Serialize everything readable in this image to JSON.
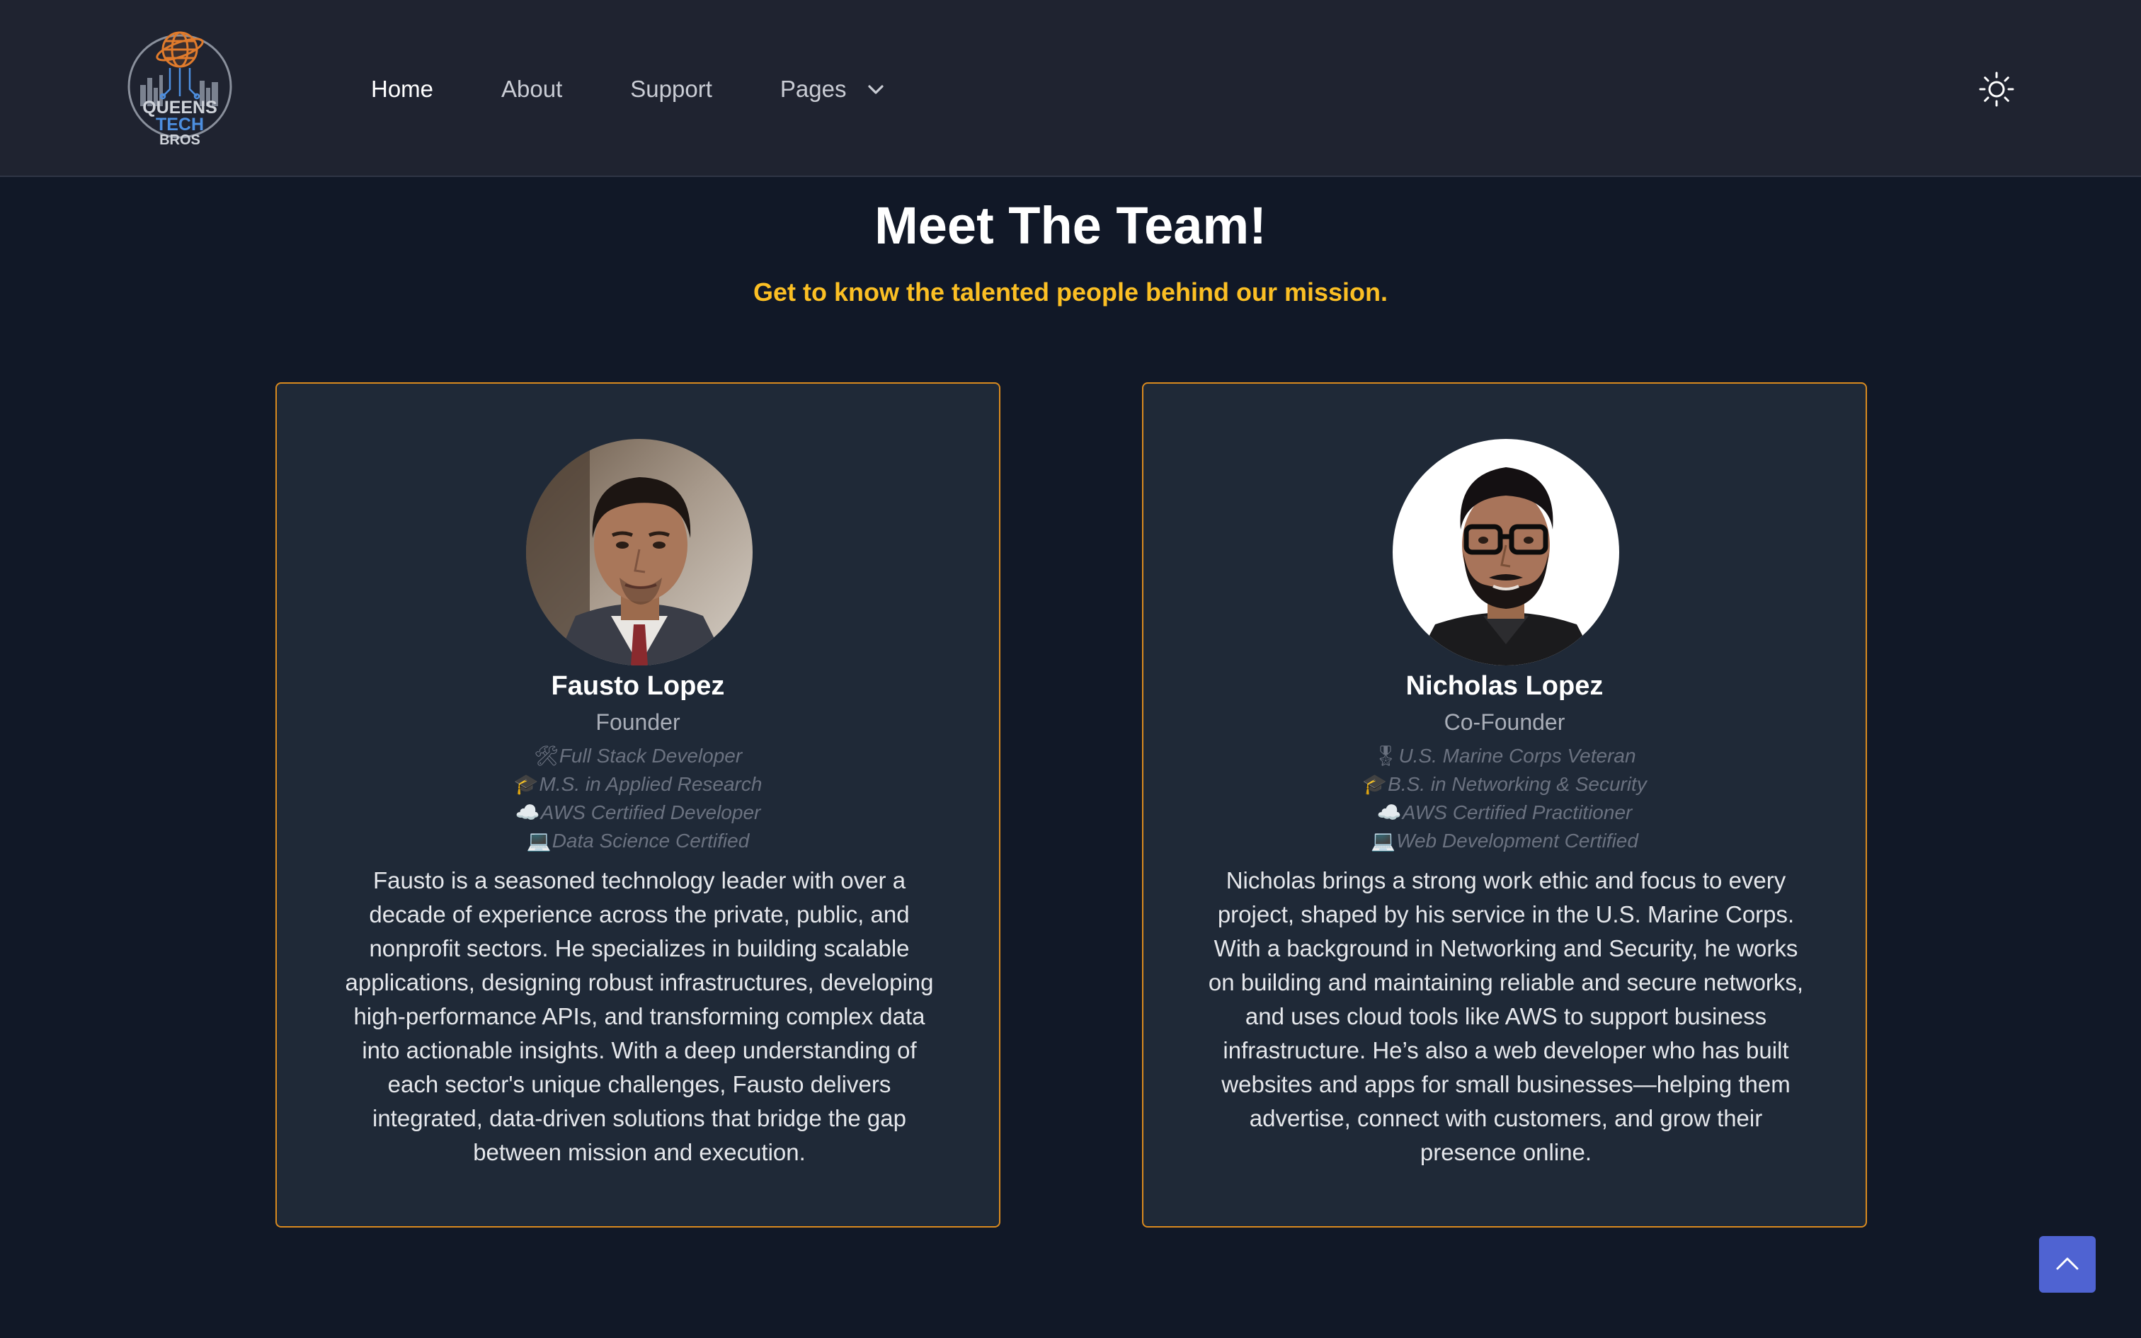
{
  "header": {
    "logo": {
      "line1": "QUEENS",
      "line2": "TECH",
      "line3": "BROS",
      "colors": {
        "orange": "#e07b2c",
        "blue": "#4d8fe0",
        "gray": "#cfd3da"
      }
    },
    "nav": [
      {
        "label": "Home",
        "active": true
      },
      {
        "label": "About"
      },
      {
        "label": "Support"
      },
      {
        "label": "Pages",
        "icon": "chevron-down-icon"
      }
    ],
    "theme_toggle_icon": "sun-icon"
  },
  "page": {
    "title": "Meet The Team!",
    "subtitle": "Get to know the talented people behind our mission."
  },
  "team": [
    {
      "name": "Fausto Lopez",
      "role": "Founder",
      "credentials": [
        {
          "emoji": "🛠",
          "text": "Full Stack Developer"
        },
        {
          "emoji": "🎓",
          "text": "M.S. in Applied Research"
        },
        {
          "emoji": "☁️",
          "text": "AWS Certified Developer"
        },
        {
          "emoji": "💻",
          "text": "Data Science Certified"
        }
      ],
      "bio": "Fausto is a seasoned technology leader with over a decade of experience across the private, public, and nonprofit sectors. He specializes in building scalable applications, designing robust infrastructures, developing high-performance APIs, and transforming complex data into actionable insights. With a deep understanding of each sector's unique challenges, Fausto delivers integrated, data-driven solutions that bridge the gap between mission and execution."
    },
    {
      "name": "Nicholas Lopez",
      "role": "Co-Founder",
      "credentials": [
        {
          "emoji": "🎖",
          "text": "U.S. Marine Corps Veteran"
        },
        {
          "emoji": "🎓",
          "text": "B.S. in Networking & Security"
        },
        {
          "emoji": "☁️",
          "text": "AWS Certified Practitioner"
        },
        {
          "emoji": "💻",
          "text": "Web Development Certified"
        }
      ],
      "bio": "Nicholas brings a strong work ethic and focus to every project, shaped by his service in the U.S. Marine Corps. With a background in Networking and Security, he works on building and maintaining reliable and secure networks, and uses cloud tools like AWS to support business infrastructure. He’s also a web developer who has built websites and apps for small businesses—helping them advertise, connect with customers, and grow their presence online."
    }
  ],
  "scroll_top_icon": "chevron-up-icon",
  "colors": {
    "background": "#111827",
    "header_bg": "#1f2330",
    "card_bg": "#1f2937",
    "card_border": "#d98a1f",
    "accent_yellow": "#fbbf24",
    "scroll_button": "#4f63d2"
  }
}
